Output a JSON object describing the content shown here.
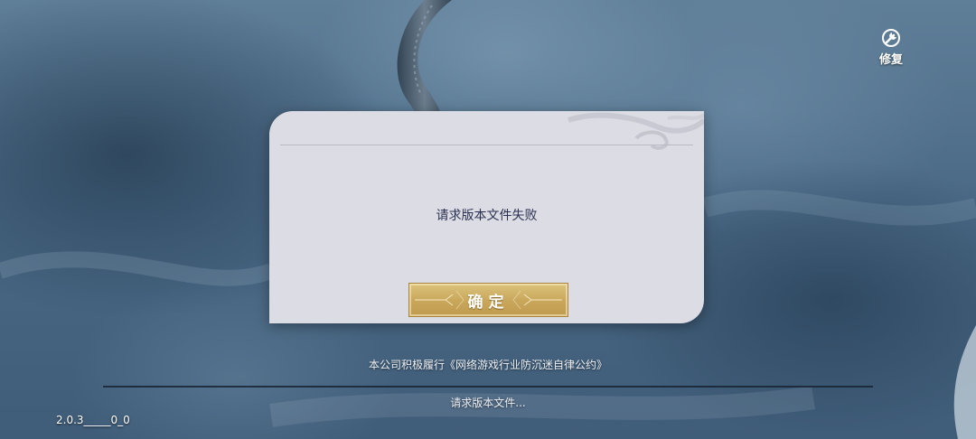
{
  "header": {
    "repair_label": "修复",
    "repair_icon": "repair-wrench-icon"
  },
  "dialog": {
    "message": "请求版本文件失败",
    "confirm_label": "确定"
  },
  "footer": {
    "notice": "本公司积极履行《网络游戏行业防沉迷自律公约》",
    "status": "请求版本文件...",
    "version": "2.0.3_____0_0"
  },
  "colors": {
    "dialog_bg": "#dcdde4",
    "button_gold": "#c8a65a",
    "message_text": "#2b3152"
  }
}
